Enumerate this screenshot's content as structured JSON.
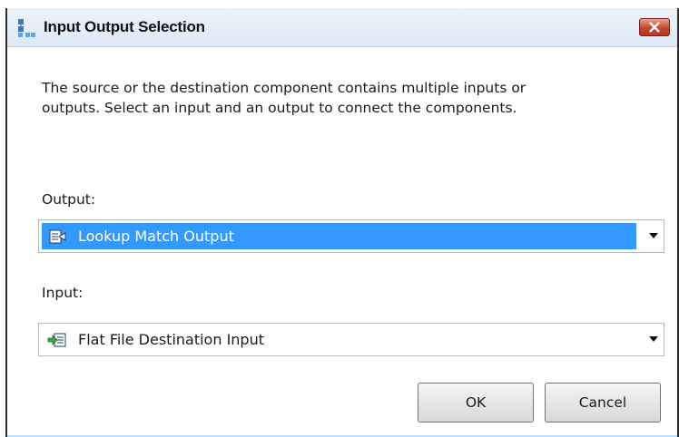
{
  "dialog": {
    "title": "Input Output Selection",
    "icon": "network-component-icon",
    "close_icon": "close-icon",
    "message_line1": "The source or the destination component contains multiple inputs or",
    "message_line2": "outputs. Select an input and an output to connect the components."
  },
  "output": {
    "label": "Output:",
    "selected": "Lookup Match Output",
    "icon": "output-icon",
    "highlight_color": "#3399ff"
  },
  "input": {
    "label": "Input:",
    "selected": "Flat File Destination Input",
    "icon": "input-icon"
  },
  "buttons": {
    "ok": "OK",
    "cancel": "Cancel"
  }
}
